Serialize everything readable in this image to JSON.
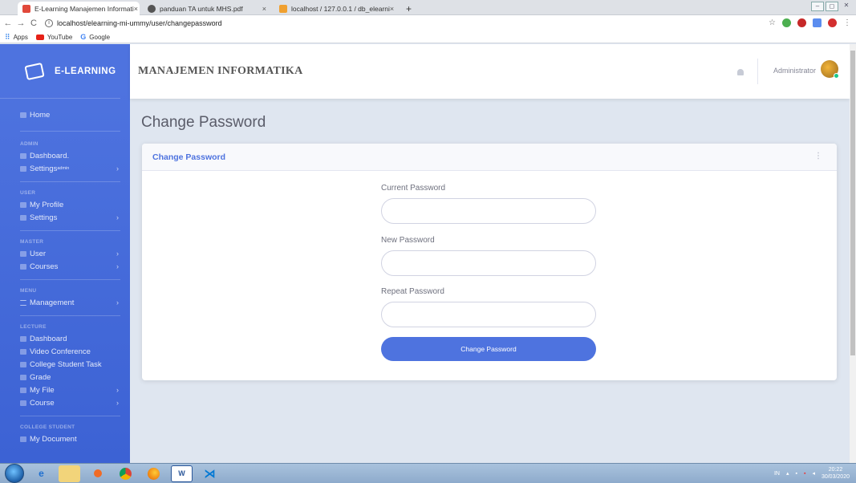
{
  "browser": {
    "tabs": [
      {
        "title": "E-Learning Manajemen Informati",
        "close": "×"
      },
      {
        "title": "panduan TA untuk MHS.pdf",
        "close": "×"
      },
      {
        "title": "localhost / 127.0.0.1 / db_elearni",
        "close": "×"
      }
    ],
    "new_tab": "+",
    "url": "localhost/elearning-mi-ummy/user/changepassword",
    "bookmarks": [
      "Apps",
      "YouTube",
      "Google"
    ]
  },
  "sidebar": {
    "brand": "E-LEARNING",
    "home": "Home",
    "sections": [
      {
        "heading": "ADMIN",
        "items": [
          {
            "label": "Dashboard.",
            "chevron": false
          },
          {
            "label": "Settings",
            "sup": "admin",
            "chevron": true
          }
        ]
      },
      {
        "heading": "USER",
        "items": [
          {
            "label": "My Profile",
            "chevron": false
          },
          {
            "label": "Settings",
            "chevron": true
          }
        ]
      },
      {
        "heading": "MASTER",
        "items": [
          {
            "label": "User",
            "chevron": true
          },
          {
            "label": "Courses",
            "chevron": true
          }
        ]
      },
      {
        "heading": "MENU",
        "items": [
          {
            "label": "Management",
            "chevron": true
          }
        ]
      },
      {
        "heading": "LECTURE",
        "items": [
          {
            "label": "Dashboard",
            "chevron": false
          },
          {
            "label": "Video Conference",
            "chevron": false
          },
          {
            "label": "College Student Task",
            "chevron": false
          },
          {
            "label": "Grade",
            "chevron": false
          },
          {
            "label": "My File",
            "chevron": true
          },
          {
            "label": "Course",
            "chevron": true
          }
        ]
      },
      {
        "heading": "COLLEGE STUDENT",
        "items": [
          {
            "label": "My Document",
            "chevron": false
          }
        ]
      }
    ]
  },
  "topbar": {
    "site_title": "MANAJEMEN INFORMATIKA",
    "user_name": "Administrator"
  },
  "page": {
    "title": "Change Password",
    "card_title": "Change Password",
    "fields": [
      {
        "label": "Current Password",
        "value": ""
      },
      {
        "label": "New Password",
        "value": ""
      },
      {
        "label": "Repeat Password",
        "value": ""
      }
    ],
    "submit_label": "Change Password"
  },
  "taskbar": {
    "lang": "IN",
    "time": "20:22",
    "date": "30/03/2020"
  },
  "colors": {
    "primary": "#4e73df",
    "page_bg": "#dfe6f0"
  }
}
